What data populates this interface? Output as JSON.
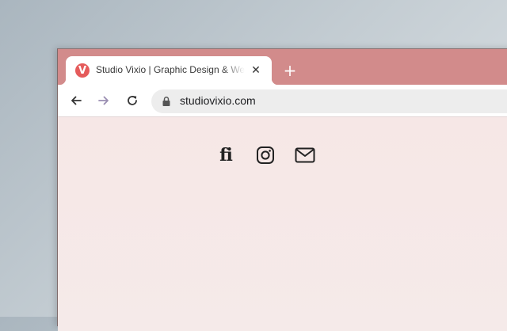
{
  "tab": {
    "title": "Studio Vixio | Graphic Design & Web Design",
    "favicon_letter": "V",
    "close_symbol": "✕"
  },
  "new_tab_symbol": "+",
  "address_bar": {
    "url": "studiovixio.com"
  },
  "social_links": {
    "fi_label": "fi",
    "instagram_icon": "instagram-icon",
    "email_icon": "envelope-icon"
  },
  "colors": {
    "tab_bar": "#d28b8b",
    "page_background": "#f5e8e8",
    "favicon": "#e55b5b"
  }
}
